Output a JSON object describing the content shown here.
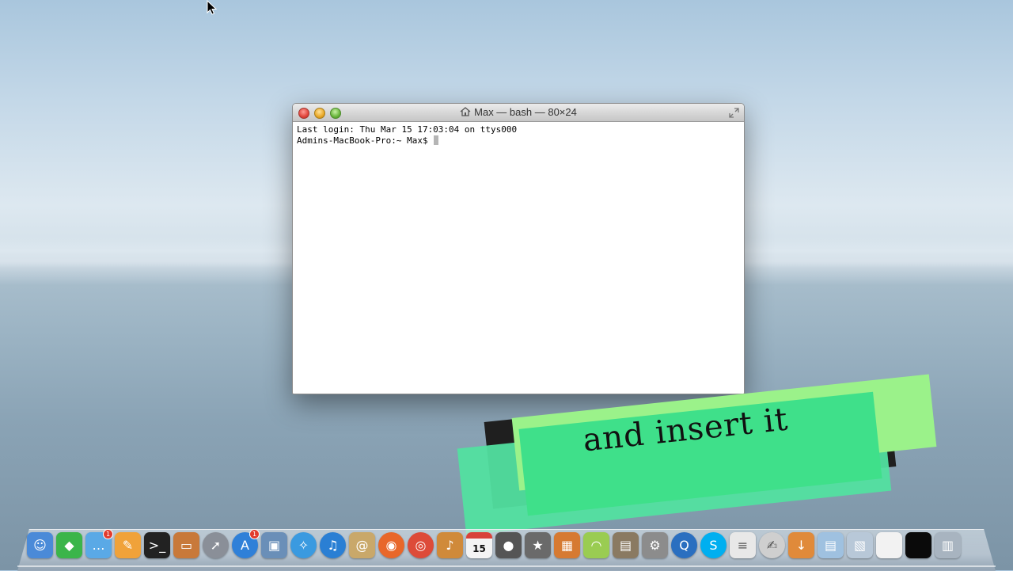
{
  "window": {
    "title": "Max — bash — 80×24",
    "lines": [
      "Last login: Thu Mar 15 17:03:04 on ttys000",
      "Admins-MacBook-Pro:~ Max$ "
    ]
  },
  "overlay": {
    "caption": "and insert it"
  },
  "dock": {
    "calendar_date": "15",
    "badges": {
      "messages": "1",
      "app_store": "1"
    },
    "items": [
      {
        "name": "finder",
        "icon": "finder-icon",
        "color": "#4a8ad8"
      },
      {
        "name": "sims",
        "icon": "plumbob-icon",
        "color": "#3bb54a"
      },
      {
        "name": "messages",
        "icon": "speech-bubble-icon",
        "color": "#5aa9e6"
      },
      {
        "name": "pages",
        "icon": "pen-icon",
        "color": "#f0a23a"
      },
      {
        "name": "terminal",
        "icon": "terminal-icon",
        "color": "#222222"
      },
      {
        "name": "keynote",
        "icon": "podium-icon",
        "color": "#c8793a"
      },
      {
        "name": "launchpad",
        "icon": "rocket-icon",
        "color": "#8a8f98"
      },
      {
        "name": "app-store",
        "icon": "app-store-icon",
        "color": "#2f80d8"
      },
      {
        "name": "preview",
        "icon": "photo-icon",
        "color": "#6a8fb8"
      },
      {
        "name": "safari",
        "icon": "compass-icon",
        "color": "#3a9ae0"
      },
      {
        "name": "itunes",
        "icon": "music-note-icon",
        "color": "#2a7fd4"
      },
      {
        "name": "contacts",
        "icon": "address-book-icon",
        "color": "#c9a86a"
      },
      {
        "name": "firefox",
        "icon": "firefox-icon",
        "color": "#e8672a"
      },
      {
        "name": "chrome",
        "icon": "chrome-icon",
        "color": "#dd4b39"
      },
      {
        "name": "garageband",
        "icon": "guitar-icon",
        "color": "#d08a3a"
      },
      {
        "name": "calendar",
        "icon": "calendar-icon",
        "color": "#f4f4f4"
      },
      {
        "name": "facetime",
        "icon": "camera-icon",
        "color": "#555555"
      },
      {
        "name": "imovie",
        "icon": "star-icon",
        "color": "#6a6a6a"
      },
      {
        "name": "iphoto",
        "icon": "palm-photo-icon",
        "color": "#d67a32"
      },
      {
        "name": "airport",
        "icon": "wifi-base-icon",
        "color": "#9acc52"
      },
      {
        "name": "activity",
        "icon": "chart-icon",
        "color": "#8a7a62"
      },
      {
        "name": "system-preferences",
        "icon": "gear-icon",
        "color": "#8c8c8c"
      },
      {
        "name": "quicktime",
        "icon": "quicktime-icon",
        "color": "#2a6fc0"
      },
      {
        "name": "skype",
        "icon": "skype-icon",
        "color": "#00aff0"
      },
      {
        "name": "textedit",
        "icon": "document-icon",
        "color": "#e8e8e8"
      },
      {
        "name": "script-editor",
        "icon": "scroll-icon",
        "color": "#cfcfcf"
      },
      {
        "name": "downloads",
        "icon": "downloads-stack-icon",
        "color": "#e08a3a"
      },
      {
        "name": "documents",
        "icon": "folder-icon",
        "color": "#9fc1e0"
      },
      {
        "name": "pictures",
        "icon": "picture-stack-icon",
        "color": "#b8c8d8"
      },
      {
        "name": "unknown-stack",
        "icon": "blank-stack-icon",
        "color": "#f2f2f2"
      },
      {
        "name": "black-stack",
        "icon": "black-window-icon",
        "color": "#0a0a0a"
      },
      {
        "name": "trash",
        "icon": "trash-icon",
        "color": "#a8b4c0"
      }
    ]
  }
}
